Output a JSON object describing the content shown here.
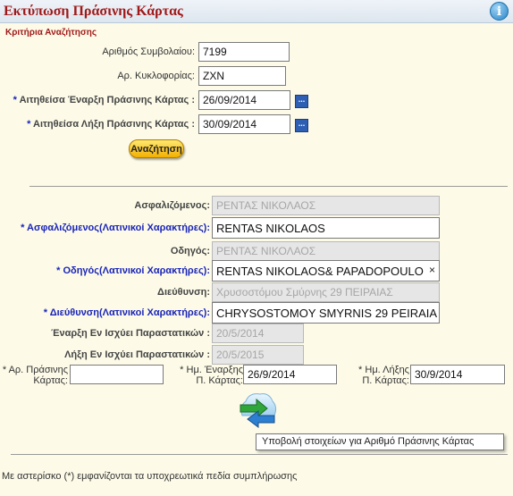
{
  "header": {
    "title": "Εκτύπωση Πράσινης Κάρτας",
    "info_icon": "info-icon"
  },
  "search": {
    "section_title": "Κριτήρια Αναζήτησης",
    "contract_label": "Αριθμός Συμβολαίου:",
    "contract_value": "7199",
    "plate_label": "Αρ. Κυκλοφορίας:",
    "plate_value": "ZXN",
    "start_label": "Αιτηθείσα Έναρξη Πράσινης Κάρτας :",
    "start_value": "26/09/2014",
    "end_label": "Αιτηθείσα Λήξη Πράσινης Κάρτας :",
    "end_value": "30/09/2014",
    "calendar_button": "...",
    "button_label": "Αναζήτηση"
  },
  "details": {
    "insured_label": "Ασφαλιζόμενος:",
    "insured_value": "ΡΕΝΤΑΣ ΝΙΚΟΛΑΟΣ",
    "insured_latin_label": "Ασφαλιζόμενος(Λατινικοί Χαρακτήρες):",
    "insured_latin_value": "RENTAS NIKOLAOS",
    "driver_label": "Οδηγός:",
    "driver_value": "ΡΕΝΤΑΣ ΝΙΚΟΛΑΟΣ",
    "driver_latin_label": "Οδηγός(Λατινικοί Χαρακτήρες):",
    "driver_latin_value": "RENTAS NIKOLAOS& PAPADOPOULO",
    "clear_glyph": "×",
    "address_label": "Διεύθυνση:",
    "address_value": "Χρυσοστόμου Σμύρνης 29 ΠΕΙΡΑΙΑΣ",
    "address_latin_label": "Διεύθυνση(Λατινικοί Χαρακτήρες):",
    "address_latin_value": "CHRYSOSTOMOY SMYRNIS 29 PEIRAIA",
    "valid_start_label": "Έναρξη Εν Ισχύει Παραστατικών :",
    "valid_start_value": "20/5/2014",
    "valid_end_label": "Λήξη Εν Ισχύει Παραστατικών :",
    "valid_end_value": "20/5/2015",
    "gc_number_label_1": "Αρ. Πράσινης",
    "gc_number_label_2": "Κάρτας:",
    "gc_number_value": "",
    "gc_start_label_1": "Ημ. Έναρξης",
    "gc_start_label_2": "Π. Κάρτας:",
    "gc_start_value": "26/9/2014",
    "gc_end_label_1": "Ημ. Λήξης",
    "gc_end_label_2": "Π. Κάρτας:",
    "gc_end_value": "30/9/2014",
    "asterisk": "*"
  },
  "submit": {
    "icon": "submit-arrows-icon",
    "tooltip": "Υποβολή στοιχείων για Αριθμό Πράσινης Κάρτας"
  },
  "footer": {
    "note": "Με αστερίσκο (*) εμφανίζονται τα υποχρεωτικά πεδία συμπλήρωσης"
  }
}
